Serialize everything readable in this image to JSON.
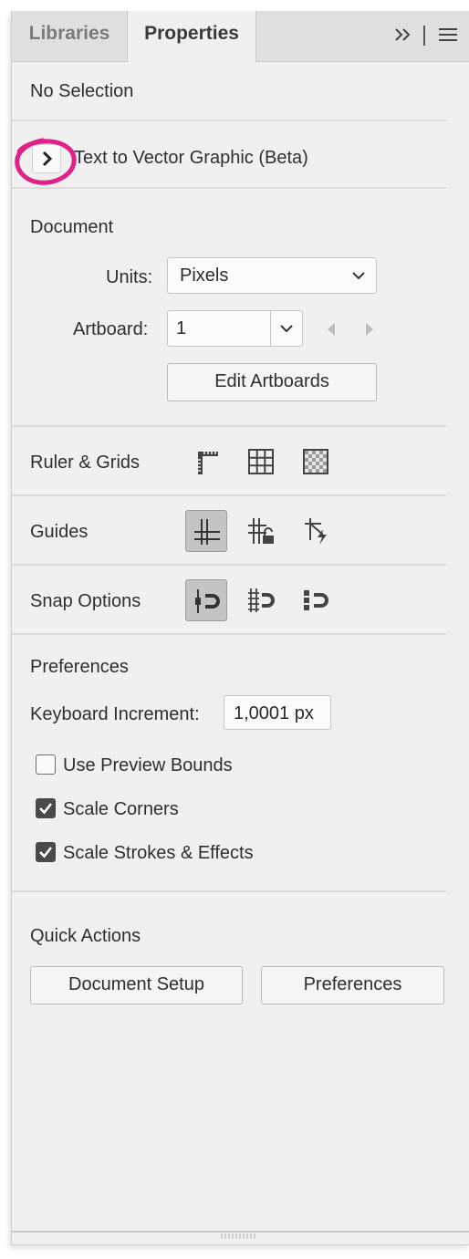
{
  "tabs": {
    "libraries": "Libraries",
    "properties": "Properties",
    "active": "Properties"
  },
  "header_icons": {
    "more": "double-chevron-right-icon",
    "menu": "hamburger-menu-icon"
  },
  "selection_status": "No Selection",
  "text_to_vector": {
    "label": "Text to Vector Graphic (Beta)",
    "expanded": false
  },
  "document": {
    "heading": "Document",
    "units_label": "Units:",
    "units_value": "Pixels",
    "artboard_label": "Artboard:",
    "artboard_value": "1",
    "edit_artboards": "Edit Artboards"
  },
  "ruler_grids": {
    "label": "Ruler & Grids",
    "icons": [
      "ruler-icon",
      "grid-icon",
      "transparency-grid-icon"
    ]
  },
  "guides": {
    "label": "Guides",
    "icons": [
      "guides-icon",
      "lock-guides-icon",
      "smart-guides-icon"
    ],
    "active_index": 0
  },
  "snap_options": {
    "label": "Snap Options",
    "icons": [
      "snap-to-point-icon",
      "snap-to-grid-icon",
      "snap-to-pixel-icon"
    ],
    "active_index": 0
  },
  "preferences": {
    "heading": "Preferences",
    "keyboard_increment_label": "Keyboard Increment:",
    "keyboard_increment_value": "1,0001 px",
    "checkboxes": [
      {
        "label": "Use Preview Bounds",
        "checked": false
      },
      {
        "label": "Scale Corners",
        "checked": true
      },
      {
        "label": "Scale Strokes & Effects",
        "checked": true
      }
    ]
  },
  "quick_actions": {
    "heading": "Quick Actions",
    "buttons": [
      "Document Setup",
      "Preferences"
    ]
  },
  "colors": {
    "panel_bg": "#f0f0f0",
    "tab_bar_bg": "#e0e0e0",
    "active_toggle_bg": "#c4c4c4",
    "annotation": "#e0218a"
  }
}
